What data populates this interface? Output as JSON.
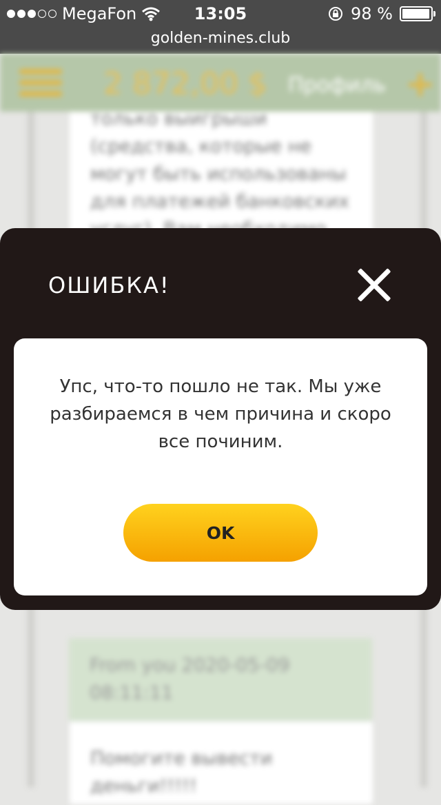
{
  "status_bar": {
    "carrier": "MegaFon",
    "time": "13:05",
    "battery": "98 %",
    "battery_level": 0.98,
    "signal_dots": [
      true,
      true,
      true,
      false,
      false
    ]
  },
  "browser": {
    "url": "golden-mines.club"
  },
  "background_page": {
    "header": {
      "balance": "2 872,00 $",
      "profile_label": "Профиль"
    },
    "message_fragment": "только выигрыши\n(средства, которые не\nмогут быть использованы\nдля платежей банковских\nуслуг). Вам необходимо",
    "chat_meta": "From you 2020-05-09\n08:11:11",
    "chat_text": "Помогите вывести\nденьги!!!!!"
  },
  "modal": {
    "title": "ОШИБКА!",
    "message": "Упс, что-то пошло не так. Мы уже разбираемся в чем причина и скоро все починим.",
    "ok_label": "OK"
  },
  "icons": {
    "close": "close-icon",
    "wifi": "wifi-icon",
    "lock": "orientation-lock-icon",
    "menu": "hamburger-menu-icon",
    "add": "plus-icon"
  },
  "colors": {
    "modal_bg": "#211817",
    "button_top": "#ffd21e",
    "button_bottom": "#f5a100",
    "header_bg": "#b5c7a9",
    "gold": "#e8c056"
  }
}
